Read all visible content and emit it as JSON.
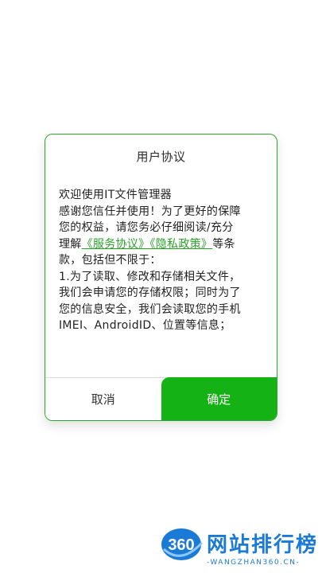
{
  "dialog": {
    "title": "用户协议",
    "body": {
      "line1": "欢迎使用IT文件管理器",
      "line2": "感谢您信任并使用！为了更好的保障",
      "line3": "您的权益，请您务必仔细阅读/充分",
      "line4_prefix": "理解",
      "link_service": "《服务协议》",
      "link_privacy": "《隐私政策》",
      "line4_suffix": "等条",
      "line5": "款，包括但不限于：",
      "line6": "1.为了读取、修改和存储相关文件，",
      "line7": "我们会申请您的存储权限；同时为了",
      "line8": "您的信息安全，我们会读取您的手机",
      "line9": "IMEI、AndroidID、位置等信息；"
    },
    "cancel_label": "取消",
    "confirm_label": "确定"
  },
  "watermark": {
    "logo_text": "360",
    "name": "网站排行榜",
    "domain": "-WANGZHAN360.CN-"
  },
  "colors": {
    "accent": "#14b214",
    "link": "#2aa12a",
    "watermark": "#1b7ad6"
  }
}
